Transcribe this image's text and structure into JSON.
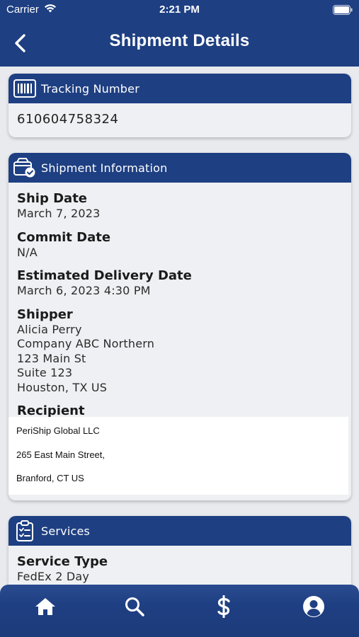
{
  "status_bar": {
    "carrier": "Carrier",
    "time": "2:21 PM"
  },
  "nav": {
    "title": "Shipment Details",
    "back_icon": "chevron-left-icon"
  },
  "colors": {
    "brand": "#1e3f82",
    "background": "#e9eaee",
    "card": "#eef0f3"
  },
  "tracking": {
    "header": "Tracking Number",
    "icon": "barcode-icon",
    "value": "610604758324"
  },
  "shipment_info": {
    "header": "Shipment Information",
    "icon": "package-check-icon",
    "ship_date": {
      "label": "Ship Date",
      "value": "March 7, 2023"
    },
    "commit_date": {
      "label": "Commit Date",
      "value": "N/A"
    },
    "estimated_delivery": {
      "label": "Estimated Delivery Date",
      "value": "March 6, 2023 4:30 PM"
    },
    "shipper": {
      "label": "Shipper",
      "lines": [
        "Alicia Perry",
        "Company ABC Northern",
        "123 Main St",
        "Suite 123",
        "Houston, TX US"
      ]
    },
    "recipient": {
      "label": "Recipient",
      "lines": [
        "PeriShip Global LLC",
        "265 East Main Street,",
        "Branford, CT US"
      ]
    }
  },
  "services": {
    "header": "Services",
    "icon": "clipboard-list-icon",
    "service_type": {
      "label": "Service Type",
      "value": "FedEx 2 Day"
    }
  },
  "tabbar": {
    "items": [
      {
        "name": "home",
        "icon": "home-icon"
      },
      {
        "name": "search",
        "icon": "search-icon"
      },
      {
        "name": "billing",
        "icon": "dollar-icon"
      },
      {
        "name": "profile",
        "icon": "user-circle-icon"
      }
    ]
  }
}
